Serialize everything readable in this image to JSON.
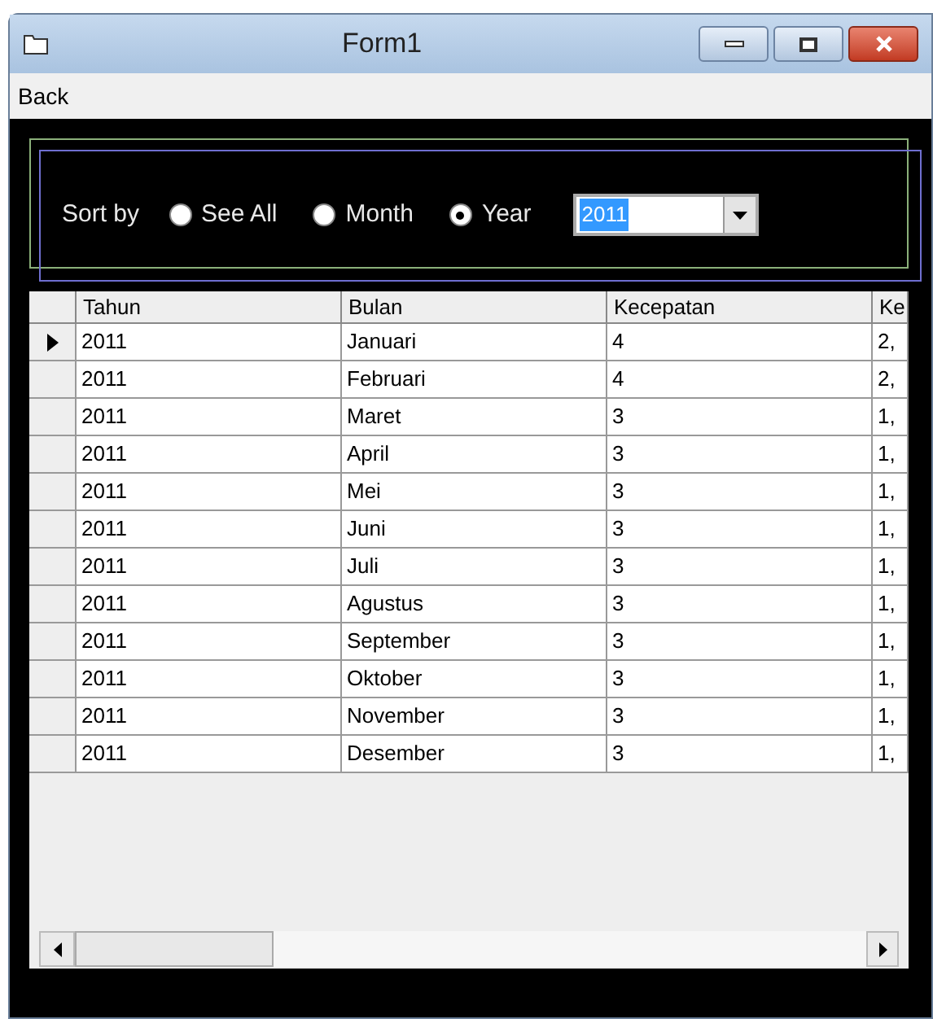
{
  "window": {
    "title": "Form1"
  },
  "menu": [
    "Back"
  ],
  "sort": {
    "label": "Sort by",
    "options": [
      {
        "label": "See All",
        "selected": false
      },
      {
        "label": "Month",
        "selected": false
      },
      {
        "label": "Year",
        "selected": true
      }
    ],
    "year": "2011"
  },
  "table": {
    "columns": [
      "Tahun",
      "Bulan",
      "Kecepatan",
      "Ke"
    ],
    "rows": [
      {
        "current": true,
        "cells": [
          "2011",
          "Januari",
          "4",
          "2,"
        ]
      },
      {
        "current": false,
        "cells": [
          "2011",
          "Februari",
          "4",
          "2,"
        ]
      },
      {
        "current": false,
        "cells": [
          "2011",
          "Maret",
          "3",
          "1,"
        ]
      },
      {
        "current": false,
        "cells": [
          "2011",
          "April",
          "3",
          "1,"
        ]
      },
      {
        "current": false,
        "cells": [
          "2011",
          "Mei",
          "3",
          "1,"
        ]
      },
      {
        "current": false,
        "cells": [
          "2011",
          "Juni",
          "3",
          "1,"
        ]
      },
      {
        "current": false,
        "cells": [
          "2011",
          "Juli",
          "3",
          "1,"
        ]
      },
      {
        "current": false,
        "cells": [
          "2011",
          "Agustus",
          "3",
          "1,"
        ]
      },
      {
        "current": false,
        "cells": [
          "2011",
          "September",
          "3",
          "1,"
        ]
      },
      {
        "current": false,
        "cells": [
          "2011",
          "Oktober",
          "3",
          "1,"
        ]
      },
      {
        "current": false,
        "cells": [
          "2011",
          "November",
          "3",
          "1,"
        ]
      },
      {
        "current": false,
        "cells": [
          "2011",
          "Desember",
          "3",
          "1,"
        ]
      }
    ]
  }
}
